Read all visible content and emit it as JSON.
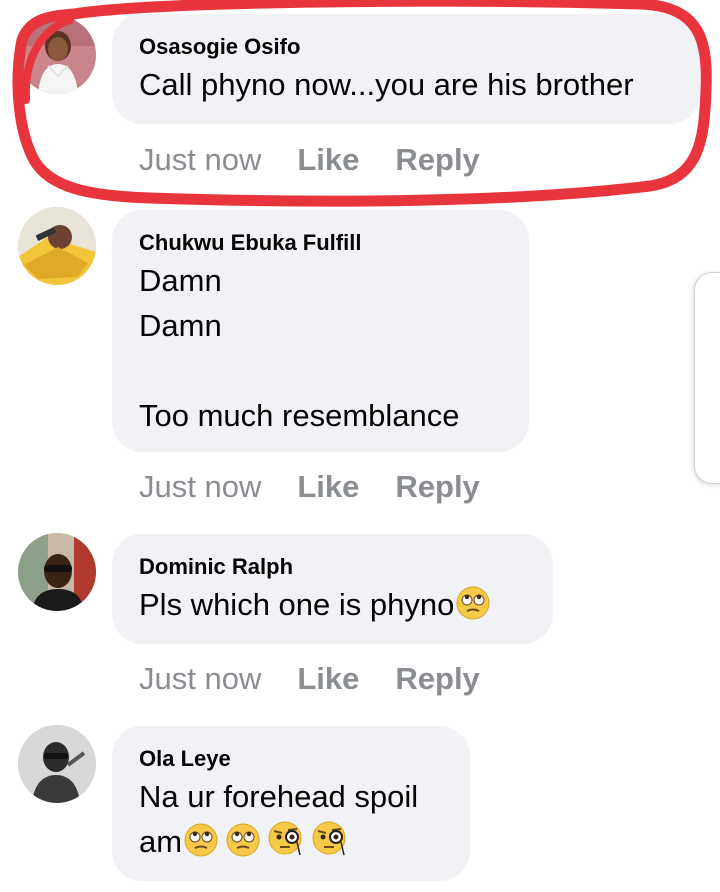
{
  "comments": [
    {
      "author": "Osasogie Osifo",
      "lines": [
        "Call phyno now...you are his brother"
      ],
      "time": "Just now",
      "like": "Like",
      "reply": "Reply",
      "avatar_icon": "profile-photo-woman",
      "highlighted": true
    },
    {
      "author": "Chukwu Ebuka Fulfill",
      "lines": [
        "Damn",
        "Damn",
        "",
        "Too much resemblance"
      ],
      "time": "Just now",
      "like": "Like",
      "reply": "Reply",
      "avatar_icon": "profile-photo-man-yellow"
    },
    {
      "author": "Dominic Ralph",
      "lines": [
        "Pls which one is phyno"
      ],
      "emojis": [
        "face-with-rolling-eyes"
      ],
      "time": "Just now",
      "like": "Like",
      "reply": "Reply",
      "avatar_icon": "profile-photo-man-sunglasses"
    },
    {
      "author": "Ola Leye",
      "lines": [
        "Na ur forehead spoil",
        "am"
      ],
      "emojis": [
        "face-with-rolling-eyes",
        "face-with-rolling-eyes",
        "face-with-monocle",
        "face-with-monocle"
      ],
      "avatar_icon": "profile-photo-man-black-white"
    }
  ],
  "colors": {
    "bubble": "#f0f2f5",
    "author_text": "#050505",
    "meta_text": "#8a8d91",
    "highlight_stroke": "#e8343c"
  }
}
